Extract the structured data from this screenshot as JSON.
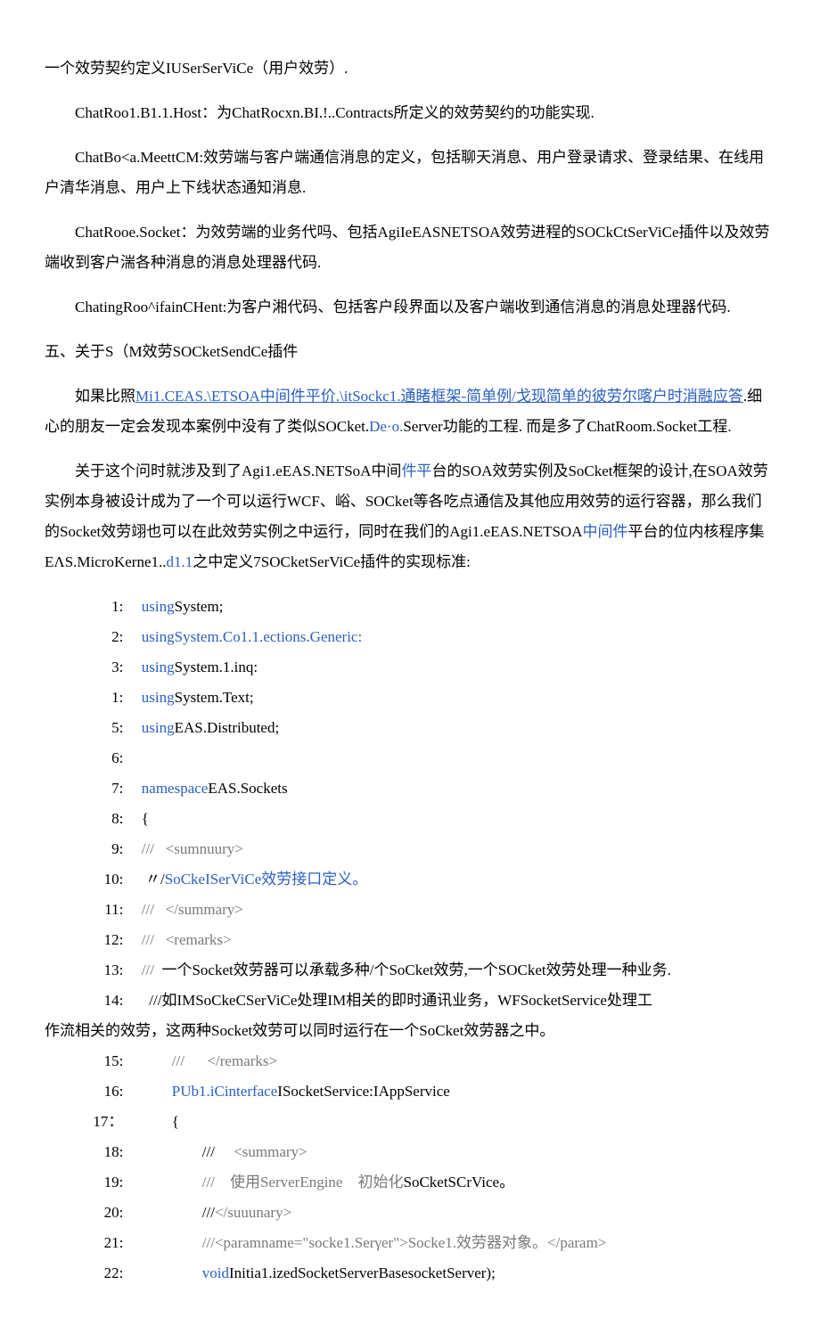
{
  "paragraphs": {
    "p1": "一个效劳契约定义IUSerSerViCe（用户效劳）.",
    "p2": "ChatRoo1.B1.1.Host：为ChatRocxn.BI.!..Contracts所定义的效劳契约的功能实现.",
    "p3": "ChatBo<a.MeettCM:效劳端与客户端通信消息的定义，包括聊天消息、用户登录请求、登录结果、在线用户清华消息、用户上下线状态通知消息.",
    "p4": "ChatRooe.Socket：为效劳端的业务代吗、包括AgiIeEASNETSOA效劳进程的SOCkCtSerViCe插件以及效劳端收到客户湍各种消息的消息处理器代码.",
    "p5": "ChatingRoo^ifainCHent:为客户湘代码、包括客户段界面以及客户端收到通信消息的消息处理器代码.",
    "h1": "五、关于S（M效劳SOCketSendCe插件",
    "p6_a": "如果比照",
    "p6_link": "Mi1.CEAS.\\ETSOA中间件平价.\\itSockc1.通睹框架-简单例/戈现简单的彼劳尔喀户时消融应答",
    "p6_b": ".细心的朋友一定会发现本案例中没有了类似SOCket.",
    "p6_blue": "De·o.",
    "p6_c": "Server功能的工程. 而是多了ChatRoom.Socket工程.",
    "p7_a": "关于这个问时就涉及到了Agi1.eEAS.NETSoA中间",
    "p7_blue1": "件平",
    "p7_b": "台的SOA效劳实例及SoCket框架的设计,在SOA效劳实例本身被设计成为了一个可以运行WCF、峪、SOCket等各吃点通信及其他应用效劳的运行容器，那么我们的Socket效劳翊也可以在此效劳实例之中运行，同时在我们的Agi1.eEAS.NETSOA",
    "p7_blue2": "中间件",
    "p7_c": "平台的位内核程序集EΛS.MicroKerne1..",
    "p7_blue3": "d1.1",
    "p7_d": "之中定义7SOCketSerViCe插件的实现标准:"
  },
  "code": [
    {
      "n": "1:",
      "k": "using",
      "t": "System;"
    },
    {
      "n": "2:",
      "full_blue": "usingSystem.Co1.1.ections.Generic:"
    },
    {
      "n": "3:",
      "k": "using",
      "t": "System.1.inq:"
    },
    {
      "n": "1:",
      "k": "using",
      "t": "System.Text;"
    },
    {
      "n": "5:",
      "k": "using",
      "t": "EAS.Distributed;"
    },
    {
      "n": "6:",
      "t": ""
    },
    {
      "n": "7:",
      "k": "namespace",
      "t": "EAS.Sockets"
    },
    {
      "n": "8:",
      "t": "{"
    },
    {
      "n": "9:",
      "gray": "///   <sumnuury>"
    },
    {
      "n": "10:",
      "t": " 〃/",
      "blue_after": "SoCkeISerViCe效劳接口定义。"
    },
    {
      "n": "11:",
      "gray": "///   </summary>"
    },
    {
      "n": "12:",
      "gray": "///   <remarks>"
    },
    {
      "n": "13:",
      "pg": "/// ",
      "t": " 一个Socket效劳器可以承载多种/个SoCket效劳,一个SOCket效劳处理一种业务."
    },
    {
      "n": "14:",
      "t": "  ///如IMSoCkeCSerViCe处理IM相关的即时通讯业务，WFSocketService处理工"
    }
  ],
  "wrap_line": "作流相关的效劳，这两种Socket效劳可以同时运行在一个SoCket效劳器之中。",
  "code2": [
    {
      "n": "15:",
      "indent": "        ",
      "gray": "///      </remarks>"
    },
    {
      "n": "16:",
      "indent": "        ",
      "blue": "PUb1.iCinterface",
      "t": "ISocketService:IAppService"
    },
    {
      "n": "17：",
      "indent": "        ",
      "t": "{"
    },
    {
      "n": "18:",
      "indent": "                ",
      "t": "///     ",
      "gray2": "<summary>"
    },
    {
      "n": "19:",
      "indent": "                ",
      "gray": "///    使用ServerEngine    初始化",
      "t2": "SoCketSCrVice。"
    },
    {
      "n": "20:",
      "indent": "                ",
      "t": "///",
      "gray2": "</suuunary>"
    },
    {
      "n": "21:",
      "indent": "                ",
      "gray": "///<paramname=\"socke1.Serγer\">Socke1.效劳器对象。</param>"
    },
    {
      "n": "22:",
      "indent": "                ",
      "blue": "void",
      "t": "Initia1.izedSocketServerBasesocketServer);"
    }
  ]
}
